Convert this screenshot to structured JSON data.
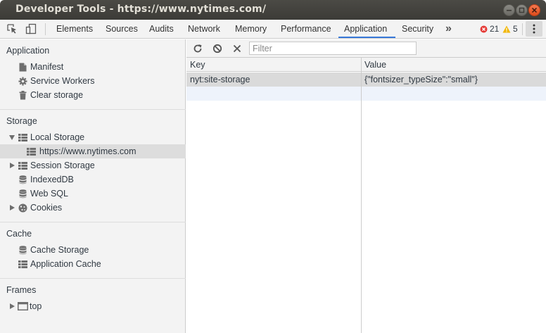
{
  "window": {
    "title": "Developer Tools - https://www.nytimes.com/"
  },
  "toolbar": {
    "tabs": [
      {
        "label": "Elements"
      },
      {
        "label": "Sources"
      },
      {
        "label": "Audits"
      },
      {
        "label": "Network"
      },
      {
        "label": "Memory"
      },
      {
        "label": "Performance"
      },
      {
        "label": "Application",
        "active": true
      },
      {
        "label": "Security"
      }
    ],
    "overflow_label": "»",
    "error_count": "21",
    "warning_count": "5"
  },
  "sidebar": {
    "application": {
      "title": "Application",
      "items": [
        {
          "label": "Manifest",
          "icon": "document-icon"
        },
        {
          "label": "Service Workers",
          "icon": "gear-icon"
        },
        {
          "label": "Clear storage",
          "icon": "trash-icon"
        }
      ]
    },
    "storage": {
      "title": "Storage",
      "items": [
        {
          "label": "Local Storage",
          "icon": "grid-icon",
          "expanded": true
        },
        {
          "label": "https://www.nytimes.com",
          "icon": "grid-icon",
          "selected": true
        },
        {
          "label": "Session Storage",
          "icon": "grid-icon"
        },
        {
          "label": "IndexedDB",
          "icon": "database-icon"
        },
        {
          "label": "Web SQL",
          "icon": "database-icon"
        },
        {
          "label": "Cookies",
          "icon": "cookie-icon"
        }
      ]
    },
    "cache": {
      "title": "Cache",
      "items": [
        {
          "label": "Cache Storage",
          "icon": "database-icon"
        },
        {
          "label": "Application Cache",
          "icon": "grid-icon"
        }
      ]
    },
    "frames": {
      "title": "Frames",
      "items": [
        {
          "label": "top",
          "icon": "frame-icon"
        }
      ]
    }
  },
  "main": {
    "filter_placeholder": "Filter",
    "columns": {
      "key": "Key",
      "value": "Value"
    },
    "rows": [
      {
        "key": "nyt:site-storage",
        "value": "{\"fontsizer_typeSize\":\"small\"}"
      }
    ]
  },
  "colors": {
    "accent": "#3879d9",
    "error": "#e53935",
    "warning": "#f2b600"
  }
}
